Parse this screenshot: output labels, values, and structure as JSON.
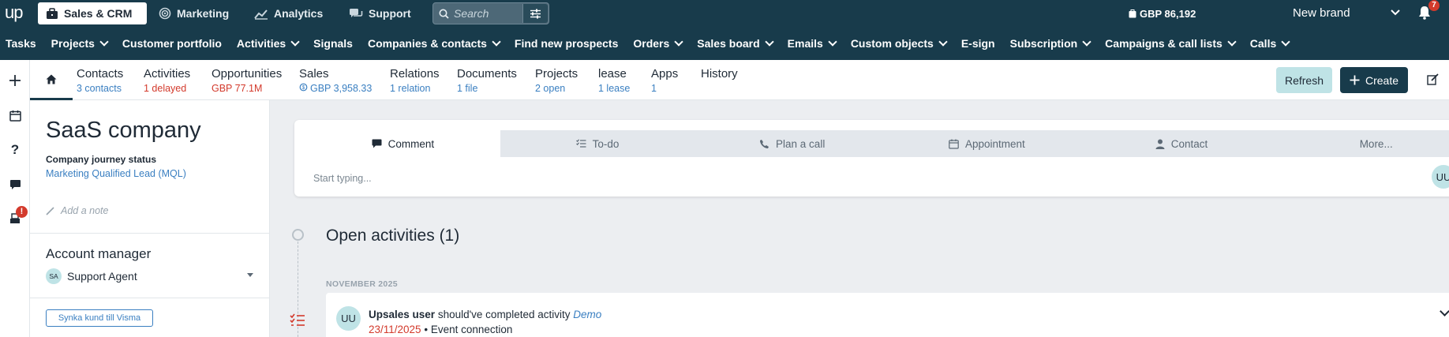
{
  "topbar": {
    "logo": "up",
    "apps": [
      {
        "label": "Sales & CRM",
        "icon": "briefcase-icon",
        "active": true
      },
      {
        "label": "Marketing",
        "icon": "target-icon"
      },
      {
        "label": "Analytics",
        "icon": "chart-line-icon"
      },
      {
        "label": "Support",
        "icon": "chat-icon"
      }
    ],
    "search_placeholder": "Search",
    "balance": "GBP 86,192",
    "brand": "New brand",
    "notifications_count": "7"
  },
  "nav": {
    "items": [
      {
        "label": "Tasks",
        "dropdown": false
      },
      {
        "label": "Projects",
        "dropdown": true
      },
      {
        "label": "Customer portfolio",
        "dropdown": false
      },
      {
        "label": "Activities",
        "dropdown": true
      },
      {
        "label": "Signals",
        "dropdown": false
      },
      {
        "label": "Companies & contacts",
        "dropdown": true
      },
      {
        "label": "Find new prospects",
        "dropdown": false
      },
      {
        "label": "Orders",
        "dropdown": true
      },
      {
        "label": "Sales board",
        "dropdown": true
      },
      {
        "label": "Emails",
        "dropdown": true
      },
      {
        "label": "Custom objects",
        "dropdown": true
      },
      {
        "label": "E-sign",
        "dropdown": false
      },
      {
        "label": "Subscription",
        "dropdown": true
      },
      {
        "label": "Campaigns & call lists",
        "dropdown": true
      },
      {
        "label": "Calls",
        "dropdown": true
      }
    ]
  },
  "rail": {
    "badge": "!"
  },
  "tabs": [
    {
      "label": "Contacts",
      "sub": "3 contacts",
      "tone": "blue"
    },
    {
      "label": "Activities",
      "sub": "1 delayed",
      "tone": "red"
    },
    {
      "label": "Opportunities",
      "sub": "GBP 77.1M",
      "tone": "red"
    },
    {
      "label": "Sales",
      "sub": "GBP 3,958.33",
      "tone": "blue"
    },
    {
      "label": "Relations",
      "sub": "1 relation",
      "tone": "gray"
    },
    {
      "label": "Documents",
      "sub": "1 file",
      "tone": "gray"
    },
    {
      "label": "Projects",
      "sub": "2 open",
      "tone": "blue"
    },
    {
      "label": "lease",
      "sub": "1 lease",
      "tone": "blue"
    },
    {
      "label": "Apps",
      "sub": "1",
      "tone": "blue"
    },
    {
      "label": "History",
      "sub": "",
      "tone": "blue"
    }
  ],
  "actions": {
    "refresh": "Refresh",
    "create": "Create"
  },
  "company": {
    "name": "SaaS company",
    "journey_label": "Company journey status",
    "journey_value": "Marketing Qualified Lead (MQL)",
    "add_note": "Add a note",
    "account_manager_title": "Account manager",
    "account_manager_initials": "SA",
    "account_manager_name": "Support Agent",
    "sync_button": "Synka kund till Visma"
  },
  "composer": {
    "tabs": [
      {
        "label": "Comment",
        "icon": "comment-icon",
        "active": true
      },
      {
        "label": "To-do",
        "icon": "todo-list-icon"
      },
      {
        "label": "Plan a call",
        "icon": "phone-icon"
      },
      {
        "label": "Appointment",
        "icon": "calendar-icon"
      },
      {
        "label": "Contact",
        "icon": "person-icon"
      },
      {
        "label": "More...",
        "icon": ""
      }
    ],
    "placeholder": "Start typing...",
    "user_initials": "UU"
  },
  "activities": {
    "title": "Open activities (1)",
    "month": "NOVEMBER 2025",
    "item": {
      "avatar": "UU",
      "user": "Upsales user",
      "text": "should've completed activity",
      "activity": "Demo",
      "date": "23/11/2025",
      "detail": "• Event connection"
    }
  },
  "colors": {
    "header_bg": "#183b4b",
    "accent_teal": "#bfe3e6",
    "link_blue": "#3a7fc1",
    "alert_red": "#d33a2c"
  }
}
